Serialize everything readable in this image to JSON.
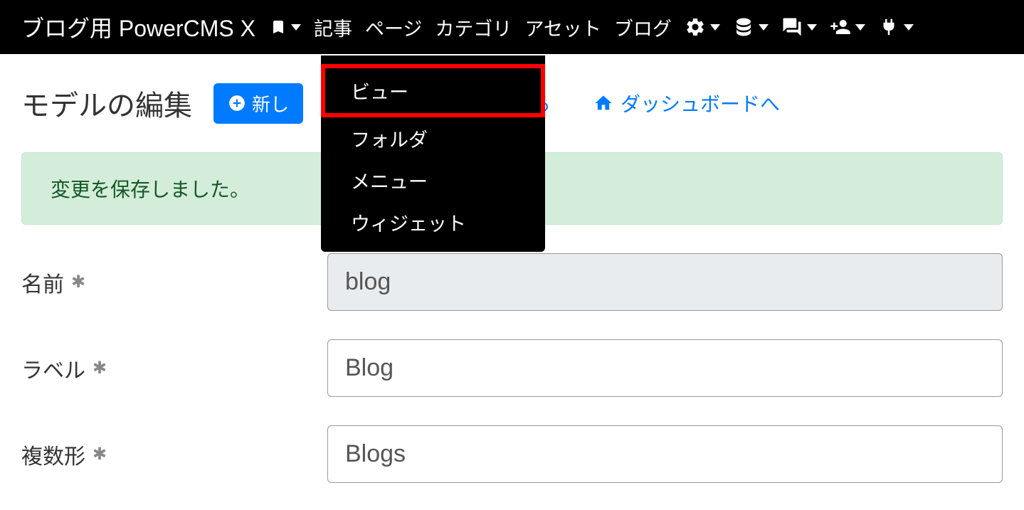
{
  "navbar": {
    "brand": "ブログ用 PowerCMS X",
    "links": {
      "article": "記事",
      "page": "ページ",
      "category": "カテゴリ",
      "asset": "アセット",
      "blog": "ブログ"
    }
  },
  "dropdown": {
    "view": "ビュー",
    "folder": "フォルダ",
    "menu": "メニュー",
    "widget": "ウィジェット"
  },
  "page": {
    "title": "モデルの編集",
    "new_button": "新し",
    "back_suffix": "る",
    "dashboard_link": "ダッシュボードへ"
  },
  "alert": {
    "success": "変更を保存しました。"
  },
  "form": {
    "name_label": "名前",
    "name_value": "blog",
    "label_label": "ラベル",
    "label_value": "Blog",
    "plural_label": "複数形",
    "plural_value": "Blogs",
    "required_mark": "✱"
  }
}
